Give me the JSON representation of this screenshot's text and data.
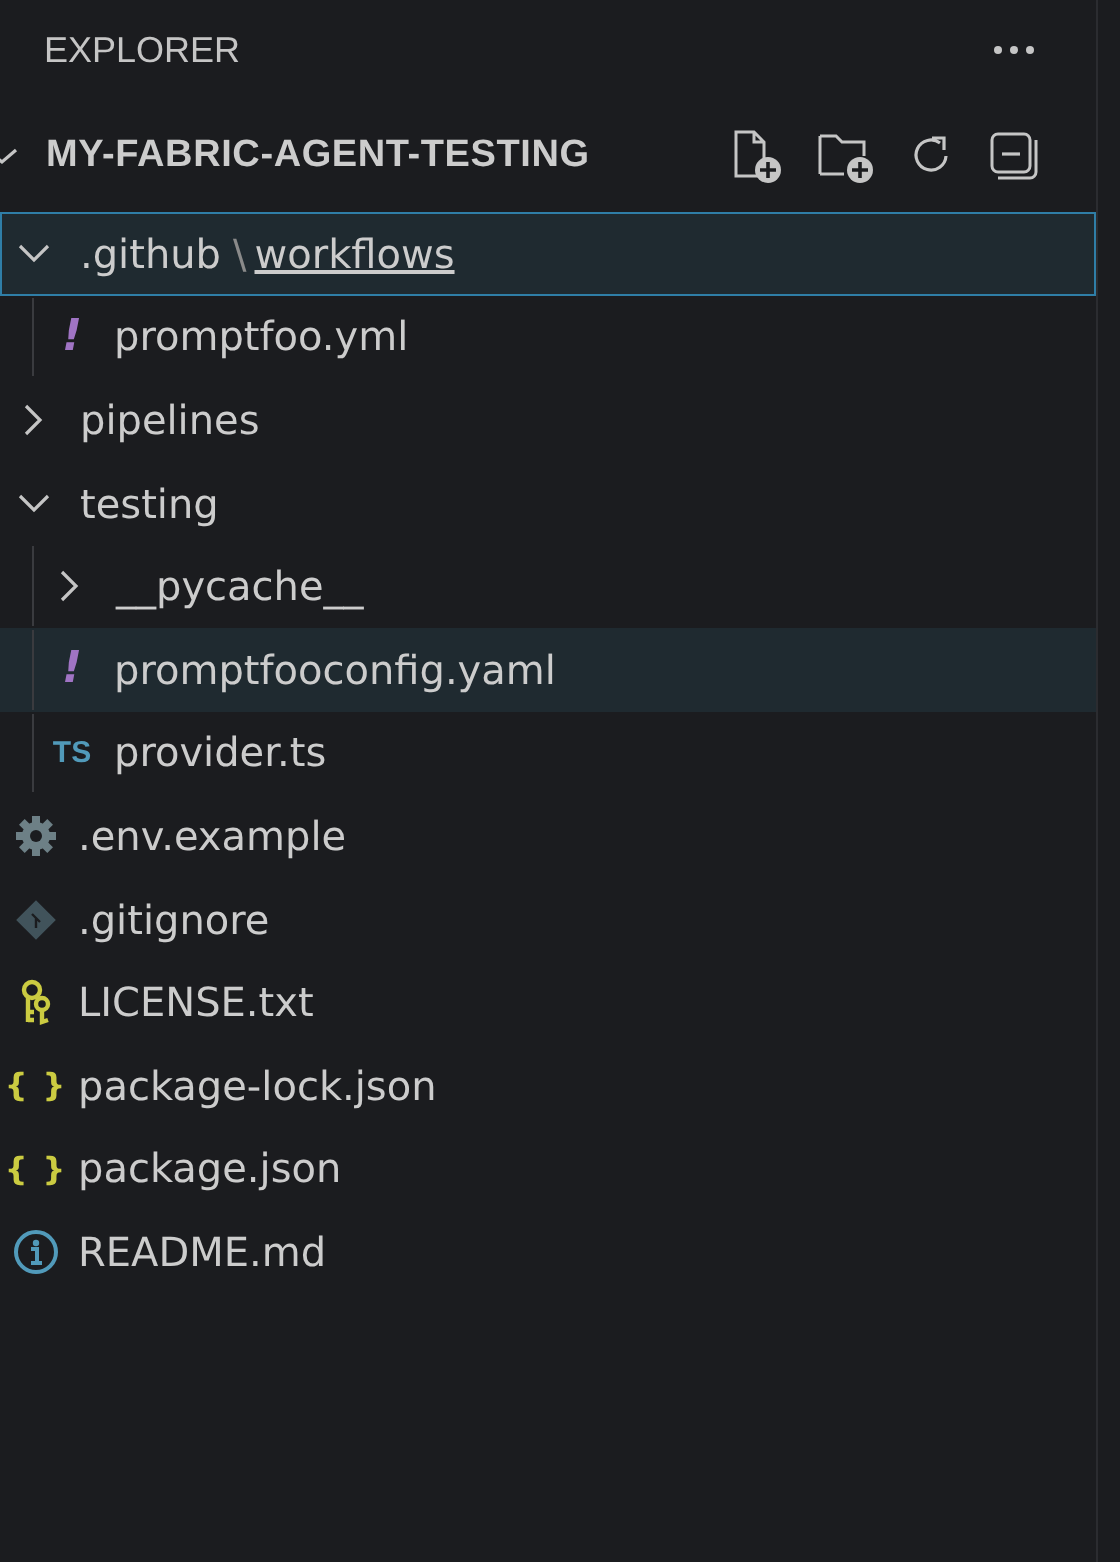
{
  "panel": {
    "title": "EXPLORER"
  },
  "root": {
    "label": "MY-FABRIC-AGENT-TESTING",
    "expanded": true
  },
  "tree": [
    {
      "kind": "folder",
      "segments": [
        ".github",
        "workflows"
      ],
      "separator": "\\",
      "expanded": true,
      "selected": true,
      "focused": true,
      "children": [
        {
          "kind": "yaml",
          "label": "promptfoo.yml",
          "icon_text": "!",
          "selected": false,
          "focused": false
        }
      ]
    },
    {
      "kind": "folder",
      "label": "pipelines",
      "expanded": false,
      "selected": false,
      "focused": false
    },
    {
      "kind": "folder",
      "label": "testing",
      "expanded": true,
      "selected": false,
      "focused": false,
      "children": [
        {
          "kind": "folder",
          "label": "__pycache__",
          "expanded": false,
          "selected": false,
          "focused": false
        },
        {
          "kind": "yaml",
          "label": "promptfooconfig.yaml",
          "icon_text": "!",
          "selected": true,
          "focused": false
        },
        {
          "kind": "ts",
          "label": "provider.ts",
          "icon_text": "TS",
          "selected": false,
          "focused": false
        }
      ]
    },
    {
      "kind": "env",
      "label": ".env.example",
      "selected": false,
      "focused": false
    },
    {
      "kind": "git",
      "label": ".gitignore",
      "selected": false,
      "focused": false
    },
    {
      "kind": "license",
      "label": "LICENSE.txt",
      "selected": false,
      "focused": false
    },
    {
      "kind": "json",
      "label": "package-lock.json",
      "icon_text": "{ }",
      "selected": false,
      "focused": false
    },
    {
      "kind": "json",
      "label": "package.json",
      "icon_text": "{ }",
      "selected": false,
      "focused": false
    },
    {
      "kind": "info",
      "label": "README.md",
      "selected": false,
      "focused": false
    }
  ]
}
